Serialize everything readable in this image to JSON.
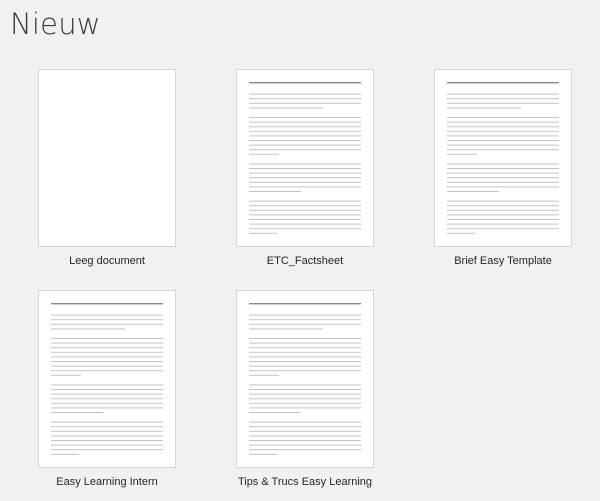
{
  "backstage": {
    "title": "Nieuw"
  },
  "templates": [
    {
      "label": "Leeg document",
      "preview": "blank"
    },
    {
      "label": "ETC_Factsheet",
      "preview": "text"
    },
    {
      "label": "Brief Easy Template",
      "preview": "text"
    },
    {
      "label": "Easy Learning Intern",
      "preview": "text"
    },
    {
      "label": "Tips & Trucs Easy Learning",
      "preview": "text"
    }
  ]
}
